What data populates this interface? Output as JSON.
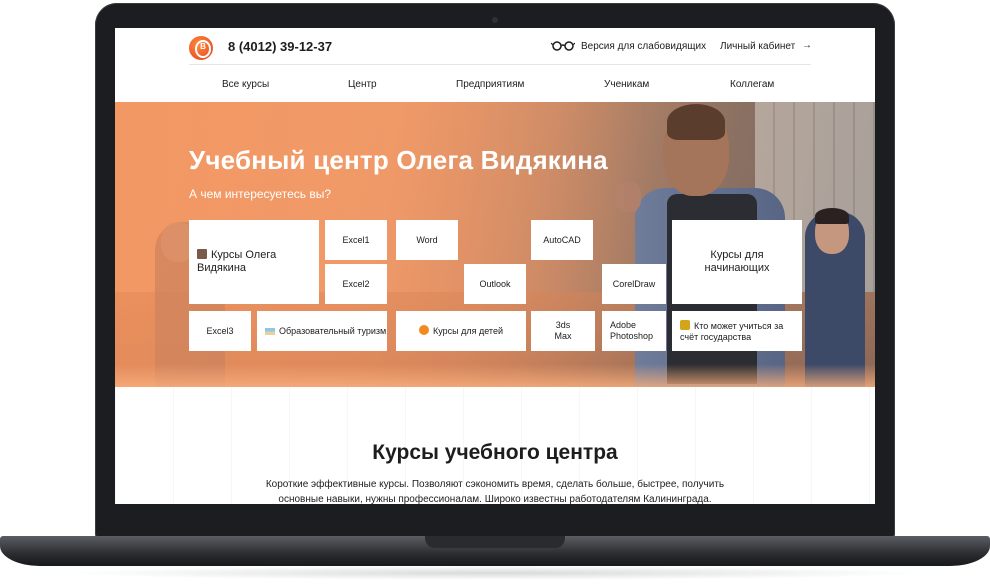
{
  "header": {
    "phone": "8 (4012) 39-12-37",
    "vision_link": "Версия для слабовидящих",
    "cabinet_link": "Личный кабинет",
    "cabinet_arrow": "→",
    "icons": [
      "logo-icon",
      "glasses-icon",
      "arrow-right-icon"
    ]
  },
  "nav": {
    "items": [
      "Все курсы",
      "Центр",
      "Предприятиям",
      "Ученикам",
      "Коллегам"
    ]
  },
  "hero": {
    "title": "Учебный центр Олега Видякина",
    "subtitle": "А чем интересуетесь вы?",
    "tiles": {
      "oleg_courses": "Курсы Олега Видякина",
      "excel1": "Excel1",
      "word": "Word",
      "autocad": "AutoCAD",
      "beginners": "Курсы для начинающих",
      "excel2": "Excel2",
      "outlook": "Outlook",
      "coreldraw": "CorelDraw",
      "excel3": "Excel3",
      "tourism": "Образовательный туризм",
      "kids": "Курсы для детей",
      "max3ds": "3ds Max",
      "photoshop": "Adobe Photoshop",
      "state_funded": "Кто может учиться за счёт государства"
    }
  },
  "section": {
    "title": "Курсы учебного центра",
    "description": "Короткие эффективные курсы. Позволяют сэкономить время, сделать больше, быстрее, получить основные навыки, нужны профессионалам. Широко известны работодателям Калининграда."
  },
  "colors": {
    "accent": "#f0773a",
    "text": "#1d1d1d",
    "laptop": "#1c1d20"
  }
}
